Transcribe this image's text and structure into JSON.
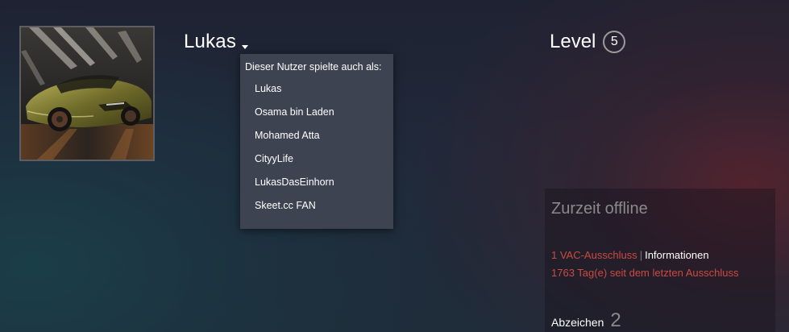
{
  "profile": {
    "persona_name": "Lukas",
    "level_label": "Level",
    "level_value": "5"
  },
  "alias_dropdown": {
    "header": "Dieser Nutzer spielte auch als:",
    "aliases": [
      "Lukas",
      "Osama bin Laden",
      "Mohamed Atta",
      "CityyLife",
      "LukasDasEinhorn",
      "Skeet.cc FAN"
    ]
  },
  "status": {
    "title": "Zurzeit offline",
    "vac_bans": "1 VAC-Ausschluss",
    "separator": "|",
    "info_link": "Informationen",
    "days_since_ban": "1763 Tag(e) seit dem letzten Ausschluss"
  },
  "badges": {
    "label": "Abzeichen",
    "count": "2"
  },
  "icons": {
    "dropdown": "chevron-down-icon",
    "avatar": "car-avatar-image"
  },
  "colors": {
    "ban_red": "#c94b43",
    "dropdown_bg": "#3d4350",
    "muted_gray": "#8a8a8a"
  }
}
